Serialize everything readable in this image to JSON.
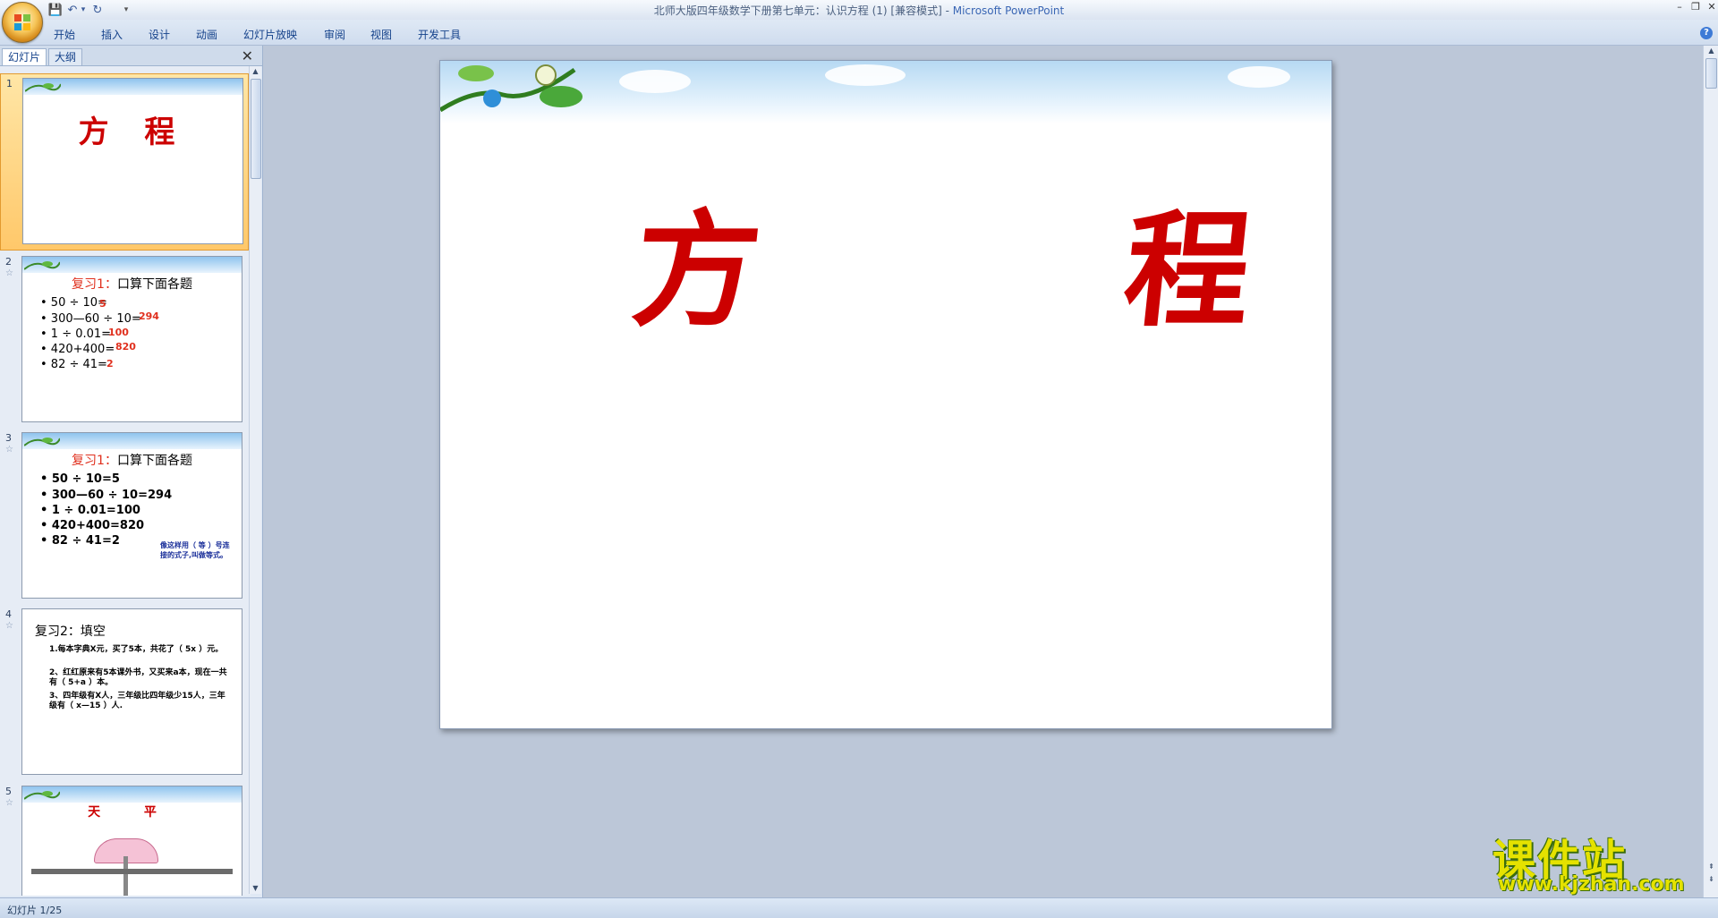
{
  "window": {
    "title": "北师大版四年级数学下册第七单元：认识方程 (1) [兼容模式]",
    "title_sep": " - ",
    "app_name": "Microsoft PowerPoint"
  },
  "qat": {
    "save": "💾",
    "undo": "↶",
    "undo_dd": "▾",
    "redo": "↻",
    "customize": "▾"
  },
  "ribbon": {
    "tabs": [
      "开始",
      "插入",
      "设计",
      "动画",
      "幻灯片放映",
      "审阅",
      "视图",
      "开发工具"
    ],
    "help": "?"
  },
  "pane": {
    "tab_slides": "幻灯片",
    "tab_outline": "大纲",
    "close": "✕"
  },
  "thumbnails": {
    "s1": {
      "num": "1",
      "title": "方 程"
    },
    "s2": {
      "num": "2",
      "head_red": "复习1：",
      "head": "口算下面各题",
      "items": [
        "• 50 ÷ 10=",
        "• 300—60 ÷ 10=",
        "• 1 ÷ 0.01=",
        "• 420+400=",
        "• 82 ÷ 41="
      ],
      "answers": [
        "5",
        "294",
        "100",
        "820",
        "2"
      ]
    },
    "s3": {
      "num": "3",
      "head_red": "复习1：",
      "head": "口算下面各题",
      "items": [
        "• 50 ÷ 10=5",
        "• 300—60 ÷ 10=294",
        "• 1 ÷ 0.01=100",
        "• 420+400=820",
        "• 82 ÷ 41=2"
      ],
      "note": "像这样用（ 等 ）号连接的式子,叫做等式。"
    },
    "s4": {
      "num": "4",
      "head": "复习2：填空",
      "lines": [
        "1.每本字典X元，买了5本，共花了（ 5x ）元。",
        "2、红红原来有5本课外书，又买来a本，现在一共有（ 5+a ）本。",
        "3、四年级有X人，三年级比四年级少15人，三年级有（ x—15 ）人."
      ]
    },
    "s5": {
      "num": "5",
      "title": "天 平"
    }
  },
  "slide": {
    "title": "方 程"
  },
  "status": {
    "text": "幻灯片 1/25"
  },
  "watermark": {
    "cn": "课件站",
    "url": "www.kjzhan.com"
  }
}
